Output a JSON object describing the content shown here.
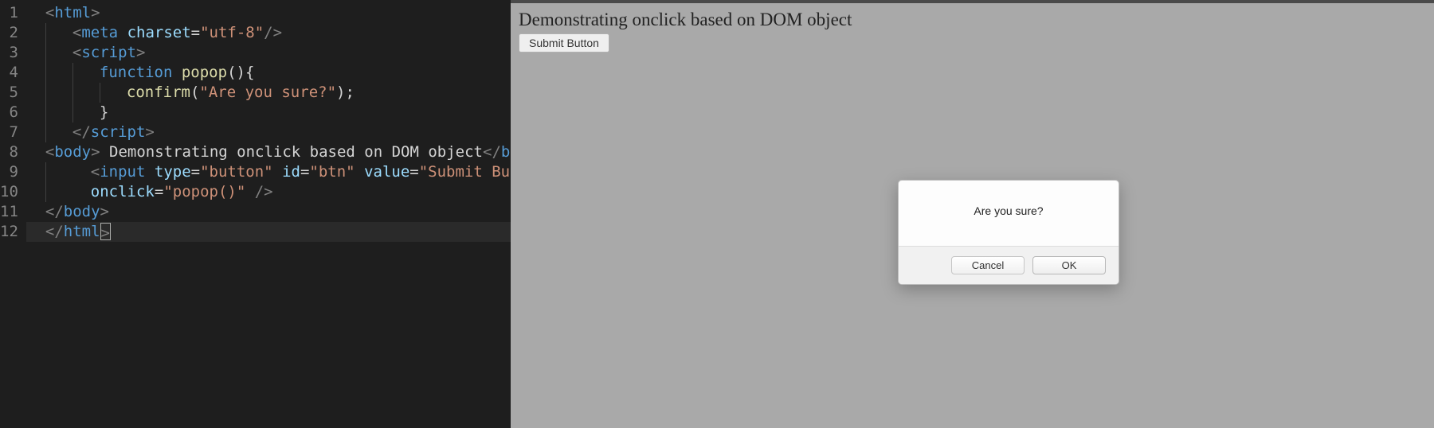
{
  "editor": {
    "line_numbers": [
      "1",
      "2",
      "3",
      "4",
      "5",
      "6",
      "7",
      "8",
      "9",
      "10",
      "11",
      "12"
    ],
    "lines": [
      {
        "indent": 1,
        "tokens": [
          {
            "cls": "tok-bracket",
            "t": "<"
          },
          {
            "cls": "tok-tag",
            "t": "html"
          },
          {
            "cls": "tok-bracket",
            "t": ">"
          }
        ]
      },
      {
        "indent": 2,
        "tokens": [
          {
            "cls": "tok-bracket",
            "t": "<"
          },
          {
            "cls": "tok-tag",
            "t": "meta"
          },
          {
            "cls": "tok-text",
            "t": " "
          },
          {
            "cls": "tok-attr",
            "t": "charset"
          },
          {
            "cls": "tok-eq",
            "t": "="
          },
          {
            "cls": "tok-string",
            "t": "\"utf-8\""
          },
          {
            "cls": "tok-bracket",
            "t": "/>"
          }
        ]
      },
      {
        "indent": 2,
        "tokens": [
          {
            "cls": "tok-bracket",
            "t": "<"
          },
          {
            "cls": "tok-tag",
            "t": "script"
          },
          {
            "cls": "tok-bracket",
            "t": ">"
          }
        ]
      },
      {
        "indent": 3,
        "tokens": [
          {
            "cls": "tok-keyword",
            "t": "function"
          },
          {
            "cls": "tok-text",
            "t": " "
          },
          {
            "cls": "tok-func",
            "t": "popop"
          },
          {
            "cls": "tok-punct",
            "t": "(){"
          }
        ]
      },
      {
        "indent": 4,
        "tokens": [
          {
            "cls": "tok-func",
            "t": "confirm"
          },
          {
            "cls": "tok-punct",
            "t": "("
          },
          {
            "cls": "tok-string",
            "t": "\"Are you sure?\""
          },
          {
            "cls": "tok-punct",
            "t": ");"
          }
        ]
      },
      {
        "indent": 3,
        "tokens": [
          {
            "cls": "tok-punct",
            "t": "}"
          }
        ]
      },
      {
        "indent": 2,
        "tokens": [
          {
            "cls": "tok-bracket",
            "t": "</"
          },
          {
            "cls": "tok-tag",
            "t": "script"
          },
          {
            "cls": "tok-bracket",
            "t": ">"
          }
        ]
      },
      {
        "indent": 1,
        "tokens": [
          {
            "cls": "tok-bracket",
            "t": "<"
          },
          {
            "cls": "tok-tag",
            "t": "body"
          },
          {
            "cls": "tok-bracket",
            "t": ">"
          },
          {
            "cls": "tok-text",
            "t": " Demonstrating onclick based on DOM object"
          },
          {
            "cls": "tok-bracket",
            "t": "</"
          },
          {
            "cls": "tok-tag",
            "t": "br"
          },
          {
            "cls": "tok-bracket",
            "t": ">"
          }
        ]
      },
      {
        "indent": 2,
        "raw": true,
        "tokens": [
          {
            "cls": "tok-text",
            "t": "  "
          },
          {
            "cls": "tok-bracket",
            "t": "<"
          },
          {
            "cls": "tok-tag",
            "t": "input"
          },
          {
            "cls": "tok-text",
            "t": " "
          },
          {
            "cls": "tok-attr",
            "t": "type"
          },
          {
            "cls": "tok-eq",
            "t": "="
          },
          {
            "cls": "tok-string",
            "t": "\"button\""
          },
          {
            "cls": "tok-text",
            "t": " "
          },
          {
            "cls": "tok-attr",
            "t": "id"
          },
          {
            "cls": "tok-eq",
            "t": "="
          },
          {
            "cls": "tok-string",
            "t": "\"btn\""
          },
          {
            "cls": "tok-text",
            "t": " "
          },
          {
            "cls": "tok-attr",
            "t": "value"
          },
          {
            "cls": "tok-eq",
            "t": "="
          },
          {
            "cls": "tok-string",
            "t": "\"Submit Button\""
          }
        ]
      },
      {
        "indent": 2,
        "raw": true,
        "tokens": [
          {
            "cls": "tok-text",
            "t": "  "
          },
          {
            "cls": "tok-attr",
            "t": "onclick"
          },
          {
            "cls": "tok-eq",
            "t": "="
          },
          {
            "cls": "tok-string",
            "t": "\"popop()\""
          },
          {
            "cls": "tok-text",
            "t": " "
          },
          {
            "cls": "tok-bracket",
            "t": "/>"
          }
        ]
      },
      {
        "indent": 1,
        "tokens": [
          {
            "cls": "tok-bracket",
            "t": "</"
          },
          {
            "cls": "tok-tag",
            "t": "body"
          },
          {
            "cls": "tok-bracket",
            "t": ">"
          }
        ]
      },
      {
        "indent": 1,
        "current": true,
        "cursorEnd": true,
        "tokens": [
          {
            "cls": "tok-bracket",
            "t": "</"
          },
          {
            "cls": "tok-tag",
            "t": "html"
          }
        ]
      }
    ]
  },
  "browser": {
    "heading": "Demonstrating onclick based on DOM object",
    "submit_label": "Submit Button",
    "dialog": {
      "message": "Are you sure?",
      "cancel_label": "Cancel",
      "ok_label": "OK"
    }
  }
}
